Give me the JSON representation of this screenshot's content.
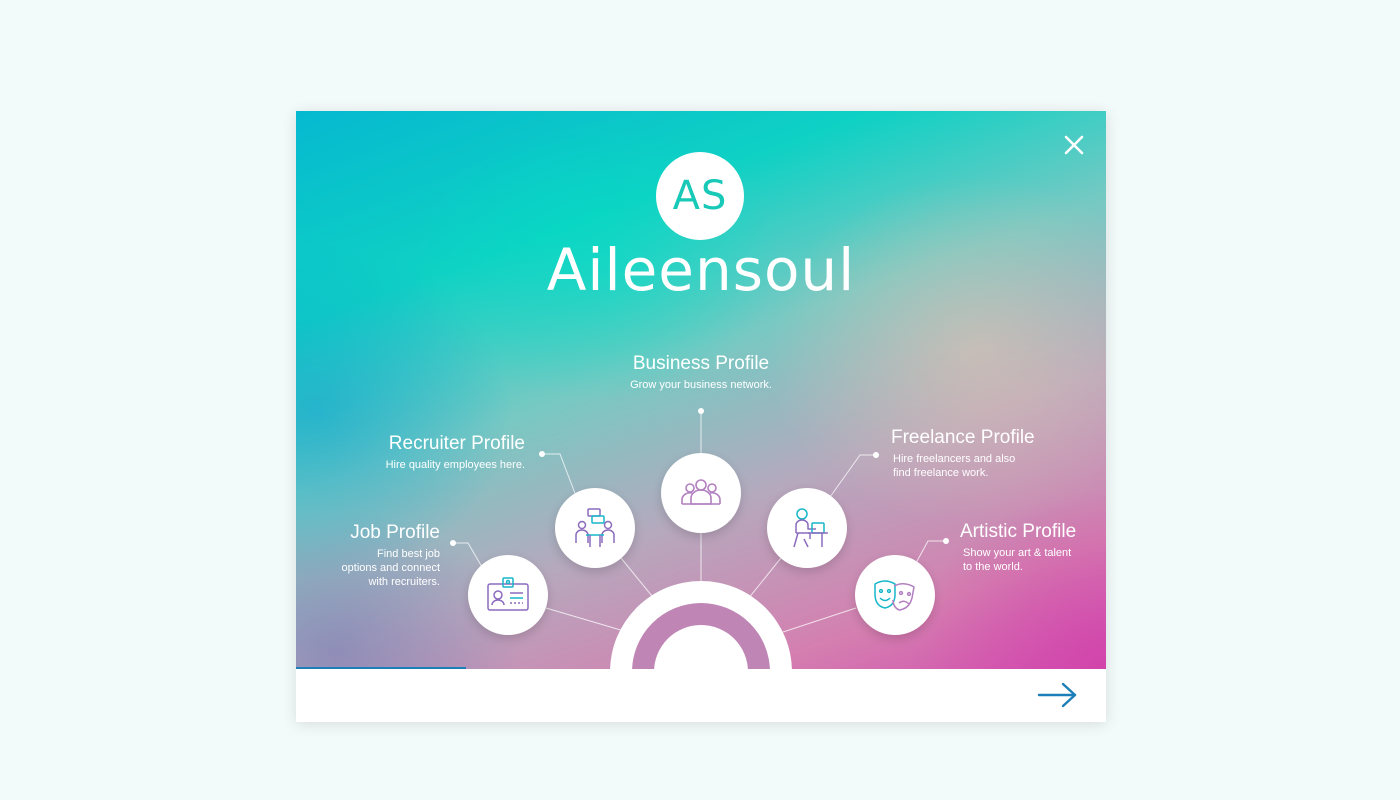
{
  "brand": {
    "logo_initials": "AS",
    "name": "Aileensoul"
  },
  "profiles": {
    "business": {
      "title": "Business Profile",
      "desc": "Grow your business network.",
      "icon": "group-icon"
    },
    "recruiter": {
      "title": "Recruiter Profile",
      "desc": "Hire quality employees here.",
      "icon": "interview-icon"
    },
    "job": {
      "title": "Job Profile",
      "desc_lines": [
        "Find best job",
        "options and connect",
        "with recruiters."
      ],
      "icon": "id-card-icon"
    },
    "freelance": {
      "title": "Freelance Profile",
      "desc_lines": [
        "Hire freelancers and also",
        "find freelance work."
      ],
      "icon": "freelancer-desk-icon"
    },
    "artistic": {
      "title": "Artistic Profile",
      "desc_lines": [
        "Show your art & talent",
        "to the world."
      ],
      "icon": "theater-masks-icon"
    }
  },
  "progress": 0.21,
  "colors": {
    "accent": "#1d7fb8",
    "logo_text": "#18c9b8",
    "icon_stroke": "#b27fc0",
    "arch": "#bf86b5"
  },
  "controls": {
    "close_icon": "close-icon",
    "next_icon": "arrow-right-icon"
  }
}
